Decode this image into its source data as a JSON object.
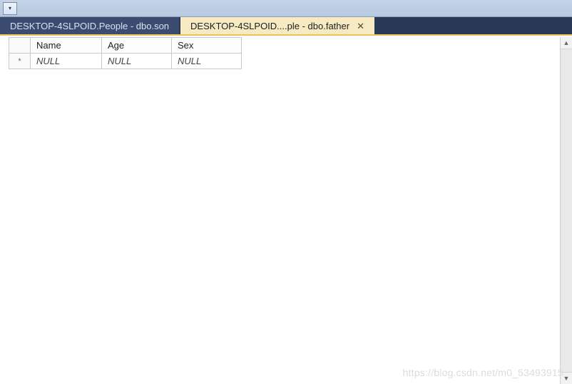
{
  "toolbar": {
    "dropdown_glyph": "▾"
  },
  "tabs": [
    {
      "label": "DESKTOP-4SLPOID.People - dbo.son",
      "active": false,
      "closable": false
    },
    {
      "label": "DESKTOP-4SLPOID....ple - dbo.father",
      "active": true,
      "closable": true,
      "close_glyph": "✕"
    }
  ],
  "grid": {
    "columns": [
      "Name",
      "Age",
      "Sex"
    ],
    "new_row_marker": "*",
    "null_text": "NULL",
    "rows": [
      {
        "is_new": true,
        "values": [
          "NULL",
          "NULL",
          "NULL"
        ]
      }
    ]
  },
  "scrollbar": {
    "up_glyph": "▲",
    "down_glyph": "▼"
  },
  "watermark": "https://blog.csdn.net/m0_53493915"
}
